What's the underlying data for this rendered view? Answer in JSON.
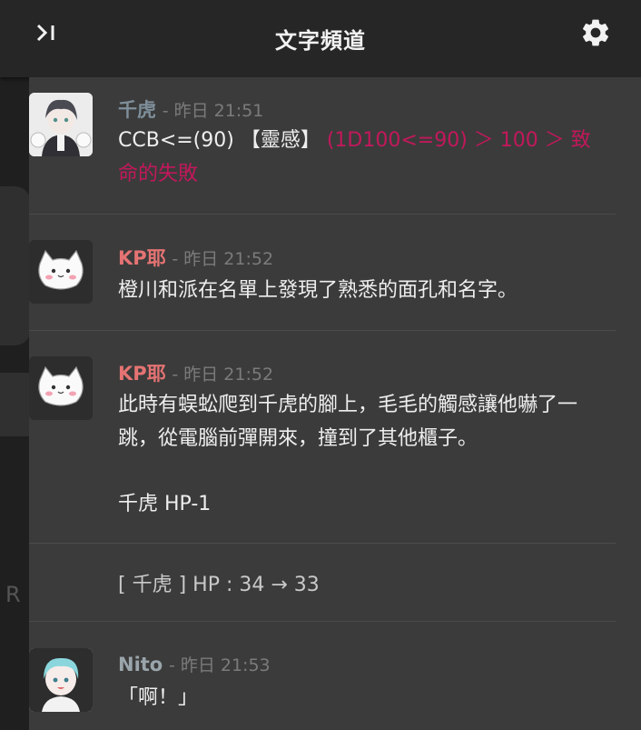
{
  "header": {
    "title": "文字頻道",
    "collapse_icon": "collapse-panel-icon",
    "settings_icon": "gear-icon"
  },
  "colors": {
    "name_chiho": "#7e8f9a",
    "name_kp": "#e57373",
    "name_nito": "#9aa5ab",
    "fail": "#c2185b"
  },
  "messages": [
    {
      "name": "千虎",
      "time": "- 昨日 21:51",
      "text": "CCB<=(90) 【靈感】",
      "roll": "(1D100<=90) ＞ 100 ＞ 致命的失敗"
    },
    {
      "name": "KP耶",
      "time": "- 昨日 21:52",
      "text": "橙川和派在名單上發現了熟悉的面孔和名字。"
    },
    {
      "name": "KP耶",
      "time": "- 昨日 21:52",
      "text": "此時有蜈蚣爬到千虎的腳上，毛毛的觸感讓他嚇了一跳，從電腦前彈開來，撞到了其他櫃子。",
      "extra": "千虎 HP-1"
    },
    {
      "system": "[ 千虎 ] HP : 34 → 33"
    },
    {
      "name": "Nito",
      "time": "- 昨日 21:53",
      "text": "「啊！」"
    }
  ],
  "background_fragment": "R"
}
